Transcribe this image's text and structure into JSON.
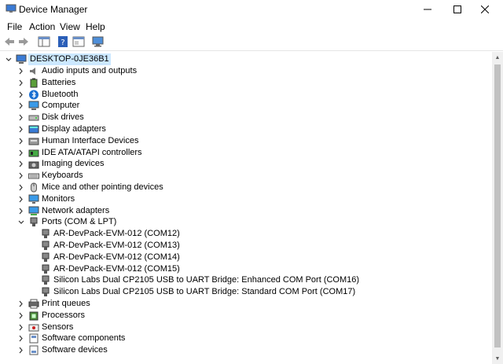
{
  "window": {
    "title": "Device Manager",
    "minimize_label": "—",
    "maximize_label": "☐",
    "close_label": "✕"
  },
  "menu": [
    "File",
    "Action",
    "View",
    "Help"
  ],
  "tree": {
    "root": "DESKTOP-0JE36B1",
    "categories": [
      "Audio inputs and outputs",
      "Batteries",
      "Bluetooth",
      "Computer",
      "Disk drives",
      "Display adapters",
      "Human Interface Devices",
      "IDE ATA/ATAPI controllers",
      "Imaging devices",
      "Keyboards",
      "Mice and other pointing devices",
      "Monitors",
      "Network adapters",
      "Ports (COM & LPT)",
      "Print queues",
      "Processors",
      "Sensors",
      "Software components",
      "Software devices"
    ],
    "ports_children": [
      "AR-DevPack-EVM-012 (COM12)",
      "AR-DevPack-EVM-012 (COM13)",
      "AR-DevPack-EVM-012 (COM14)",
      "AR-DevPack-EVM-012 (COM15)",
      "Silicon Labs Dual CP2105 USB to UART Bridge: Enhanced COM Port (COM16)",
      "Silicon Labs Dual CP2105 USB to UART Bridge: Standard COM Port (COM17)"
    ]
  },
  "icons": {
    "categories": [
      "speaker-icon",
      "battery-icon",
      "bluetooth-icon",
      "computer-icon",
      "disk-drive-icon",
      "display-adapter-icon",
      "hid-icon",
      "ide-controller-icon",
      "camera-icon",
      "keyboard-icon",
      "mouse-icon",
      "monitor-icon",
      "network-adapter-icon",
      "port-icon",
      "printer-icon",
      "processor-icon",
      "sensor-icon",
      "software-component-icon",
      "software-device-icon"
    ],
    "accent": "#cce8ff"
  }
}
